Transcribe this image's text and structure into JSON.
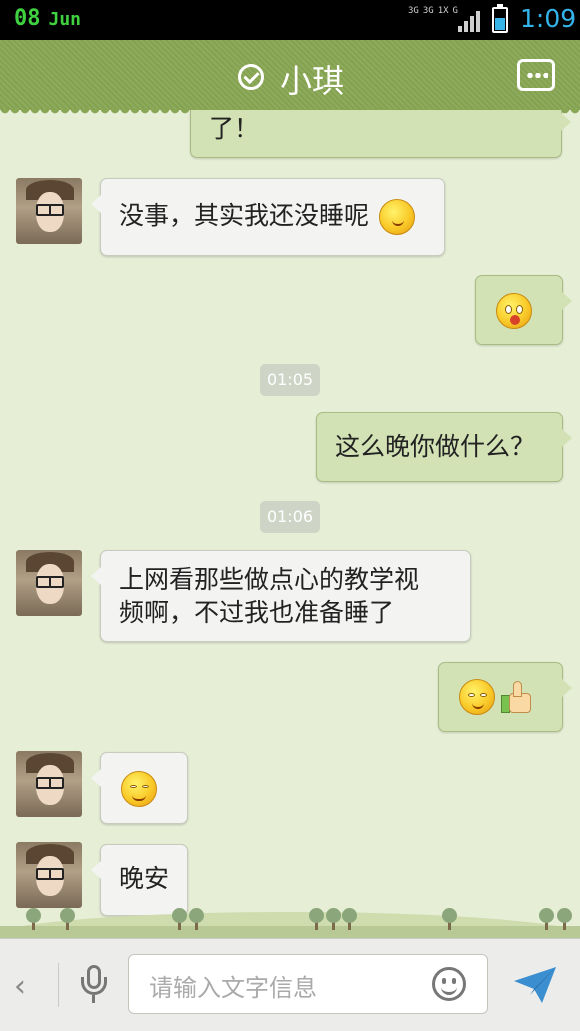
{
  "status_bar": {
    "day": "08",
    "month": "Jun",
    "network_1": "3G",
    "network_2": "3G",
    "network_3": "1X",
    "network_4": "G",
    "time": "1:09"
  },
  "header": {
    "title": "小琪"
  },
  "messages": [
    {
      "id": "m0",
      "direction": "out",
      "text": "了！"
    },
    {
      "id": "m1",
      "direction": "in",
      "text": "没事，其实我还没睡呢",
      "emoji": "smile-icon"
    },
    {
      "id": "m2",
      "direction": "out",
      "emoji": "surprised-icon"
    },
    {
      "id": "m3",
      "timestamp": "01:05"
    },
    {
      "id": "m4",
      "direction": "out",
      "text": "这么晚你做什么？"
    },
    {
      "id": "m5",
      "timestamp": "01:06"
    },
    {
      "id": "m6",
      "direction": "in",
      "line1": "上网看那些做点心的教学视",
      "line2": "频啊，不过我也准备睡了"
    },
    {
      "id": "m7",
      "direction": "out",
      "emoji": "sweat-smile-icon",
      "emoji2": "thumbs-up-icon"
    },
    {
      "id": "m8",
      "direction": "in",
      "emoji": "shy-icon"
    },
    {
      "id": "m9",
      "direction": "in",
      "text": "晚安"
    }
  ],
  "input": {
    "placeholder": "请输入文字信息"
  },
  "colors": {
    "header": "#88a653",
    "bubble_out": "#d2e2b4",
    "bubble_in": "#f3f4f1",
    "status_time": "#34b4ea",
    "status_date": "#3fd13f"
  }
}
